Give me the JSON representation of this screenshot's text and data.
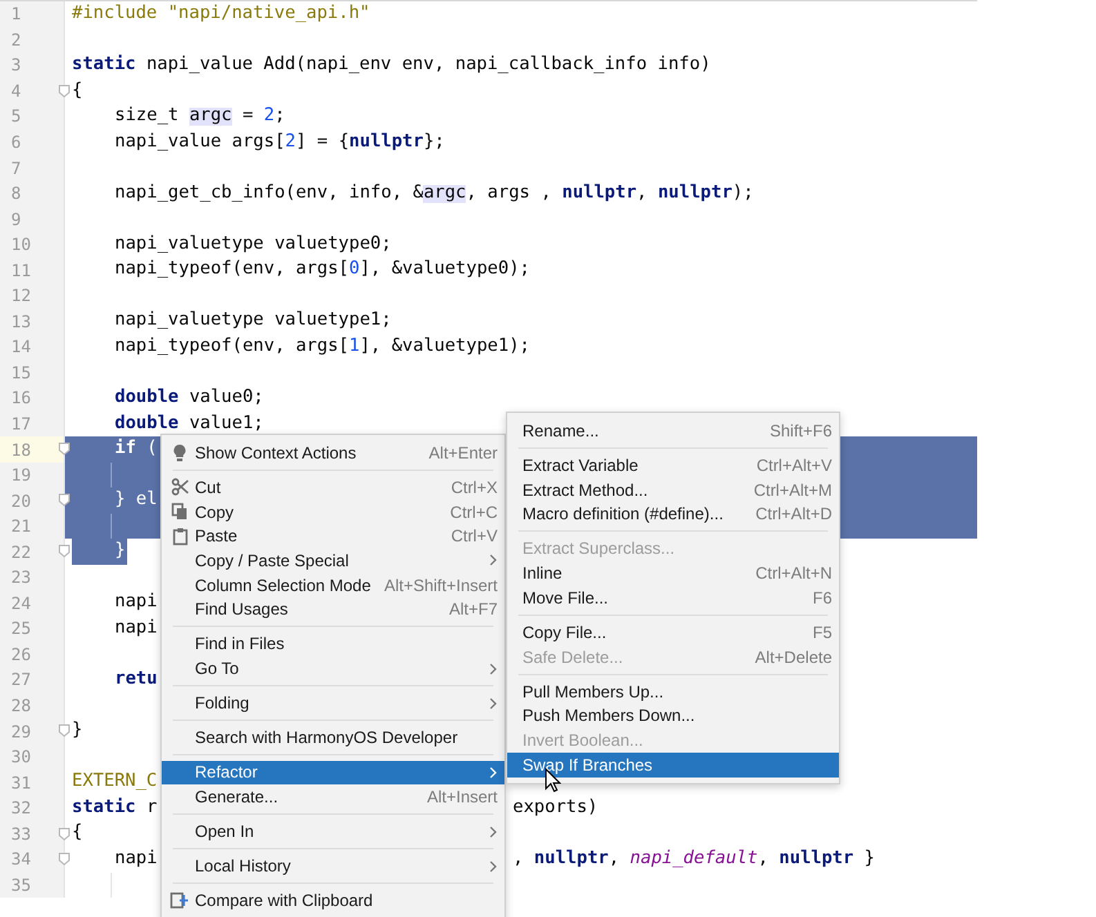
{
  "editor": {
    "lines": [
      {
        "number": "1",
        "segments": [
          {
            "text": "#include \"napi/native_api.h\"",
            "kind": "directive"
          }
        ]
      },
      {
        "number": "2"
      },
      {
        "number": "3",
        "segments": [
          {
            "text": "static",
            "kind": "keyword"
          },
          {
            "text": " napi_value Add(napi_env env, napi_callback_info info)",
            "kind": "plain"
          }
        ]
      },
      {
        "number": "4",
        "fold": true,
        "segments": [
          {
            "text": "{",
            "kind": "plain"
          }
        ]
      },
      {
        "number": "5",
        "indented": true,
        "segments": [
          {
            "text": "size_t ",
            "kind": "plain"
          },
          {
            "text": "argc",
            "kind": "usage"
          },
          {
            "text": " = ",
            "kind": "plain"
          },
          {
            "text": "2",
            "kind": "number"
          },
          {
            "text": ";",
            "kind": "plain"
          }
        ]
      },
      {
        "number": "6",
        "indented": true,
        "segments": [
          {
            "text": "napi_value args[",
            "kind": "plain"
          },
          {
            "text": "2",
            "kind": "number"
          },
          {
            "text": "] = {",
            "kind": "plain"
          },
          {
            "text": "nullptr",
            "kind": "keyword"
          },
          {
            "text": "};",
            "kind": "plain"
          }
        ]
      },
      {
        "number": "7"
      },
      {
        "number": "8",
        "indented": true,
        "segments": [
          {
            "text": "napi_get_cb_info(env, info, &",
            "kind": "plain"
          },
          {
            "text": "argc",
            "kind": "usage"
          },
          {
            "text": ", args , ",
            "kind": "plain"
          },
          {
            "text": "nullptr",
            "kind": "keyword"
          },
          {
            "text": ", ",
            "kind": "plain"
          },
          {
            "text": "nullptr",
            "kind": "keyword"
          },
          {
            "text": ");",
            "kind": "plain"
          }
        ]
      },
      {
        "number": "9"
      },
      {
        "number": "10",
        "indented": true,
        "segments": [
          {
            "text": "napi_valuetype valuetype0;",
            "kind": "plain"
          }
        ]
      },
      {
        "number": "11",
        "indented": true,
        "segments": [
          {
            "text": "napi_typeof(env, args[",
            "kind": "plain"
          },
          {
            "text": "0",
            "kind": "number"
          },
          {
            "text": "], &valuetype0);",
            "kind": "plain"
          }
        ]
      },
      {
        "number": "12"
      },
      {
        "number": "13",
        "indented": true,
        "segments": [
          {
            "text": "napi_valuetype valuetype1;",
            "kind": "plain"
          }
        ]
      },
      {
        "number": "14",
        "indented": true,
        "segments": [
          {
            "text": "napi_typeof(env, args[",
            "kind": "plain"
          },
          {
            "text": "1",
            "kind": "number"
          },
          {
            "text": "], &valuetype1);",
            "kind": "plain"
          }
        ]
      },
      {
        "number": "15"
      },
      {
        "number": "16",
        "indented": true,
        "segments": [
          {
            "text": "double",
            "kind": "keyword"
          },
          {
            "text": " value0;",
            "kind": "plain"
          }
        ]
      },
      {
        "number": "17",
        "indented": true,
        "segments": [
          {
            "text": "double",
            "kind": "keyword"
          },
          {
            "text": " value1;",
            "kind": "plain"
          }
        ]
      },
      {
        "number": "18",
        "fold": true,
        "current": true,
        "selected": true,
        "indented": true,
        "segments": [
          {
            "text": "if",
            "kind": "keyword"
          },
          {
            "text": " (",
            "kind": "plain"
          }
        ]
      },
      {
        "number": "19",
        "guide": true,
        "selected": true
      },
      {
        "number": "20",
        "fold": true,
        "selected": true,
        "indented": true,
        "segments": [
          {
            "text": "} el",
            "kind": "plain"
          }
        ]
      },
      {
        "number": "21",
        "guide": true,
        "selected": true
      },
      {
        "number": "22",
        "fold": true,
        "partly_selected": true,
        "indented": true,
        "segments": [
          {
            "text": "}",
            "kind": "plain"
          }
        ]
      },
      {
        "number": "23"
      },
      {
        "number": "24",
        "indented": true,
        "segments": [
          {
            "text": "napi",
            "kind": "plain"
          }
        ]
      },
      {
        "number": "25",
        "indented": true,
        "segments": [
          {
            "text": "napi",
            "kind": "plain"
          }
        ]
      },
      {
        "number": "26"
      },
      {
        "number": "27",
        "indented": true,
        "segments": [
          {
            "text": "retu",
            "kind": "keyword"
          }
        ]
      },
      {
        "number": "28"
      },
      {
        "number": "29",
        "fold": true,
        "segments": [
          {
            "text": "}",
            "kind": "plain"
          }
        ]
      },
      {
        "number": "30"
      },
      {
        "number": "31",
        "segments": [
          {
            "text": "EXTERN_C",
            "kind": "directive"
          }
        ]
      },
      {
        "number": "32",
        "segments": [
          {
            "text": "static",
            "kind": "keyword"
          },
          {
            "text": " r",
            "kind": "plain"
          }
        ],
        "right_segments": [
          {
            "text": "exports)",
            "kind": "plain"
          }
        ]
      },
      {
        "number": "33",
        "fold": true,
        "segments": [
          {
            "text": "{",
            "kind": "plain"
          }
        ]
      },
      {
        "number": "34",
        "fold": true,
        "indented": true,
        "segments": [
          {
            "text": "napi",
            "kind": "plain"
          }
        ],
        "right_segments": [
          {
            "text": ", ",
            "kind": "plain"
          },
          {
            "text": "nullptr",
            "kind": "keyword"
          },
          {
            "text": ", ",
            "kind": "plain"
          },
          {
            "text": "napi_default",
            "kind": "enum"
          },
          {
            "text": ", ",
            "kind": "plain"
          },
          {
            "text": "nullptr",
            "kind": "keyword"
          },
          {
            "text": " }",
            "kind": "plain"
          }
        ]
      },
      {
        "number": "35",
        "guide": true
      }
    ]
  },
  "context_menu": {
    "items": [
      {
        "kind": "item",
        "label": "Show Context Actions",
        "shortcut": "Alt+Enter",
        "submenu": false,
        "disabled": false,
        "selected": false
      },
      {
        "kind": "separator"
      },
      {
        "kind": "item",
        "label": "Cut",
        "shortcut": "Ctrl+X",
        "submenu": false,
        "disabled": false,
        "selected": false
      },
      {
        "kind": "item",
        "label": "Copy",
        "shortcut": "Ctrl+C",
        "submenu": false,
        "disabled": false,
        "selected": false
      },
      {
        "kind": "item",
        "label": "Paste",
        "shortcut": "Ctrl+V",
        "submenu": false,
        "disabled": false,
        "selected": false
      },
      {
        "kind": "item",
        "label": "Copy / Paste Special",
        "submenu": true,
        "disabled": false,
        "selected": false
      },
      {
        "kind": "item",
        "label": "Column Selection Mode",
        "shortcut": "Alt+Shift+Insert",
        "submenu": false,
        "disabled": false,
        "selected": false
      },
      {
        "kind": "item",
        "label": "Find Usages",
        "shortcut": "Alt+F7",
        "submenu": false,
        "disabled": false,
        "selected": false
      },
      {
        "kind": "separator"
      },
      {
        "kind": "item",
        "label": "Find in Files",
        "submenu": false,
        "disabled": false,
        "selected": false
      },
      {
        "kind": "item",
        "label": "Go To",
        "submenu": true,
        "disabled": false,
        "selected": false
      },
      {
        "kind": "separator"
      },
      {
        "kind": "item",
        "label": "Folding",
        "submenu": true,
        "disabled": false,
        "selected": false
      },
      {
        "kind": "separator"
      },
      {
        "kind": "item",
        "label": "Search with HarmonyOS Developer",
        "submenu": false,
        "disabled": false,
        "selected": false
      },
      {
        "kind": "separator"
      },
      {
        "kind": "item",
        "label": "Refactor",
        "submenu": true,
        "disabled": false,
        "selected": true
      },
      {
        "kind": "item",
        "label": "Generate...",
        "shortcut": "Alt+Insert",
        "submenu": false,
        "disabled": false,
        "selected": false
      },
      {
        "kind": "separator"
      },
      {
        "kind": "item",
        "label": "Open In",
        "submenu": true,
        "disabled": false,
        "selected": false
      },
      {
        "kind": "separator"
      },
      {
        "kind": "item",
        "label": "Local History",
        "submenu": true,
        "disabled": false,
        "selected": false
      },
      {
        "kind": "separator"
      },
      {
        "kind": "item",
        "label": "Compare with Clipboard",
        "submenu": false,
        "disabled": false,
        "selected": false
      }
    ]
  },
  "refactor_menu": {
    "items": [
      {
        "kind": "item",
        "label": "Rename...",
        "shortcut": "Shift+F6",
        "disabled": false,
        "selected": false
      },
      {
        "kind": "separator"
      },
      {
        "kind": "item",
        "label": "Extract Variable",
        "shortcut": "Ctrl+Alt+V",
        "disabled": false,
        "selected": false
      },
      {
        "kind": "item",
        "label": "Extract Method...",
        "shortcut": "Ctrl+Alt+M",
        "disabled": false,
        "selected": false
      },
      {
        "kind": "item",
        "label": "Macro definition (#define)...",
        "shortcut": "Ctrl+Alt+D",
        "disabled": false,
        "selected": false
      },
      {
        "kind": "separator"
      },
      {
        "kind": "item",
        "label": "Extract Superclass...",
        "disabled": true,
        "selected": false
      },
      {
        "kind": "item",
        "label": "Inline",
        "shortcut": "Ctrl+Alt+N",
        "disabled": false,
        "selected": false
      },
      {
        "kind": "item",
        "label": "Move File...",
        "shortcut": "F6",
        "disabled": false,
        "selected": false
      },
      {
        "kind": "separator"
      },
      {
        "kind": "item",
        "label": "Copy File...",
        "shortcut": "F5",
        "disabled": false,
        "selected": false
      },
      {
        "kind": "item",
        "label": "Safe Delete...",
        "shortcut": "Alt+Delete",
        "disabled": true,
        "selected": false
      },
      {
        "kind": "separator"
      },
      {
        "kind": "item",
        "label": "Pull Members Up...",
        "disabled": false,
        "selected": false
      },
      {
        "kind": "item",
        "label": "Push Members Down...",
        "disabled": false,
        "selected": false
      },
      {
        "kind": "item",
        "label": "Invert Boolean...",
        "disabled": true,
        "selected": false
      },
      {
        "kind": "item",
        "label": "Swap If Branches",
        "disabled": false,
        "selected": true
      }
    ]
  }
}
